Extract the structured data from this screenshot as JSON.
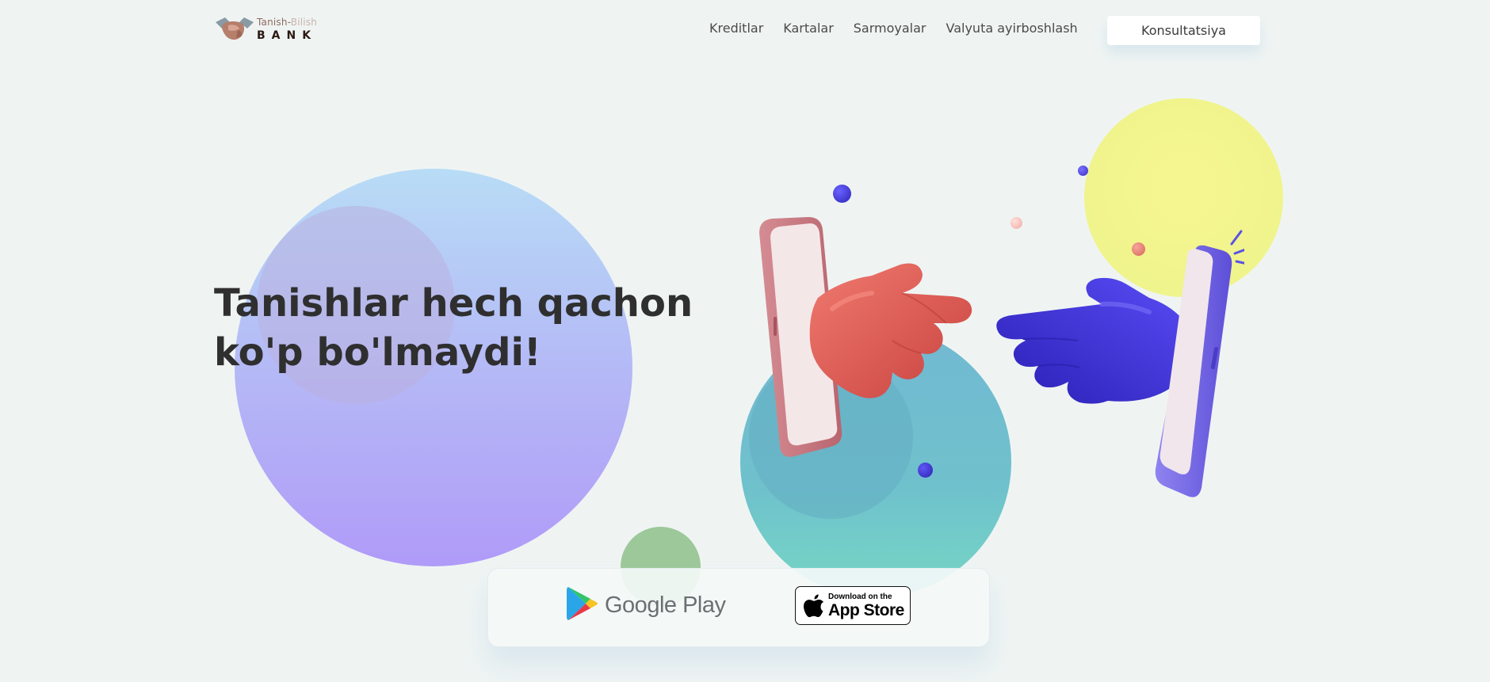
{
  "header": {
    "logo": {
      "top_pre": "Tanish-",
      "top_post": "Bilish",
      "bottom": "BANK"
    },
    "nav": [
      {
        "label": "Kreditlar"
      },
      {
        "label": "Kartalar"
      },
      {
        "label": "Sarmoyalar"
      },
      {
        "label": "Valyuta ayirboshlash"
      }
    ],
    "cta_label": "Konsultatsiya"
  },
  "hero": {
    "headline_line1": "Tanishlar hech qachon",
    "headline_line2": "ko'p bo'lmaydi!"
  },
  "stores": {
    "google_play_label": "Google Play",
    "app_store_small": "Download on the",
    "app_store_big": "App Store"
  },
  "colors": {
    "background": "#eff4f3",
    "text": "#2f2f2f",
    "red_hand": "#d9554f",
    "blue_hand": "#3a2fd6",
    "yellow_circle": "#f0f48c",
    "teal_circle": "#6fc1cc",
    "violet_circle": "#b09bf8"
  },
  "icons": [
    "handshake-logo-icon",
    "google-play-icon",
    "apple-icon"
  ]
}
